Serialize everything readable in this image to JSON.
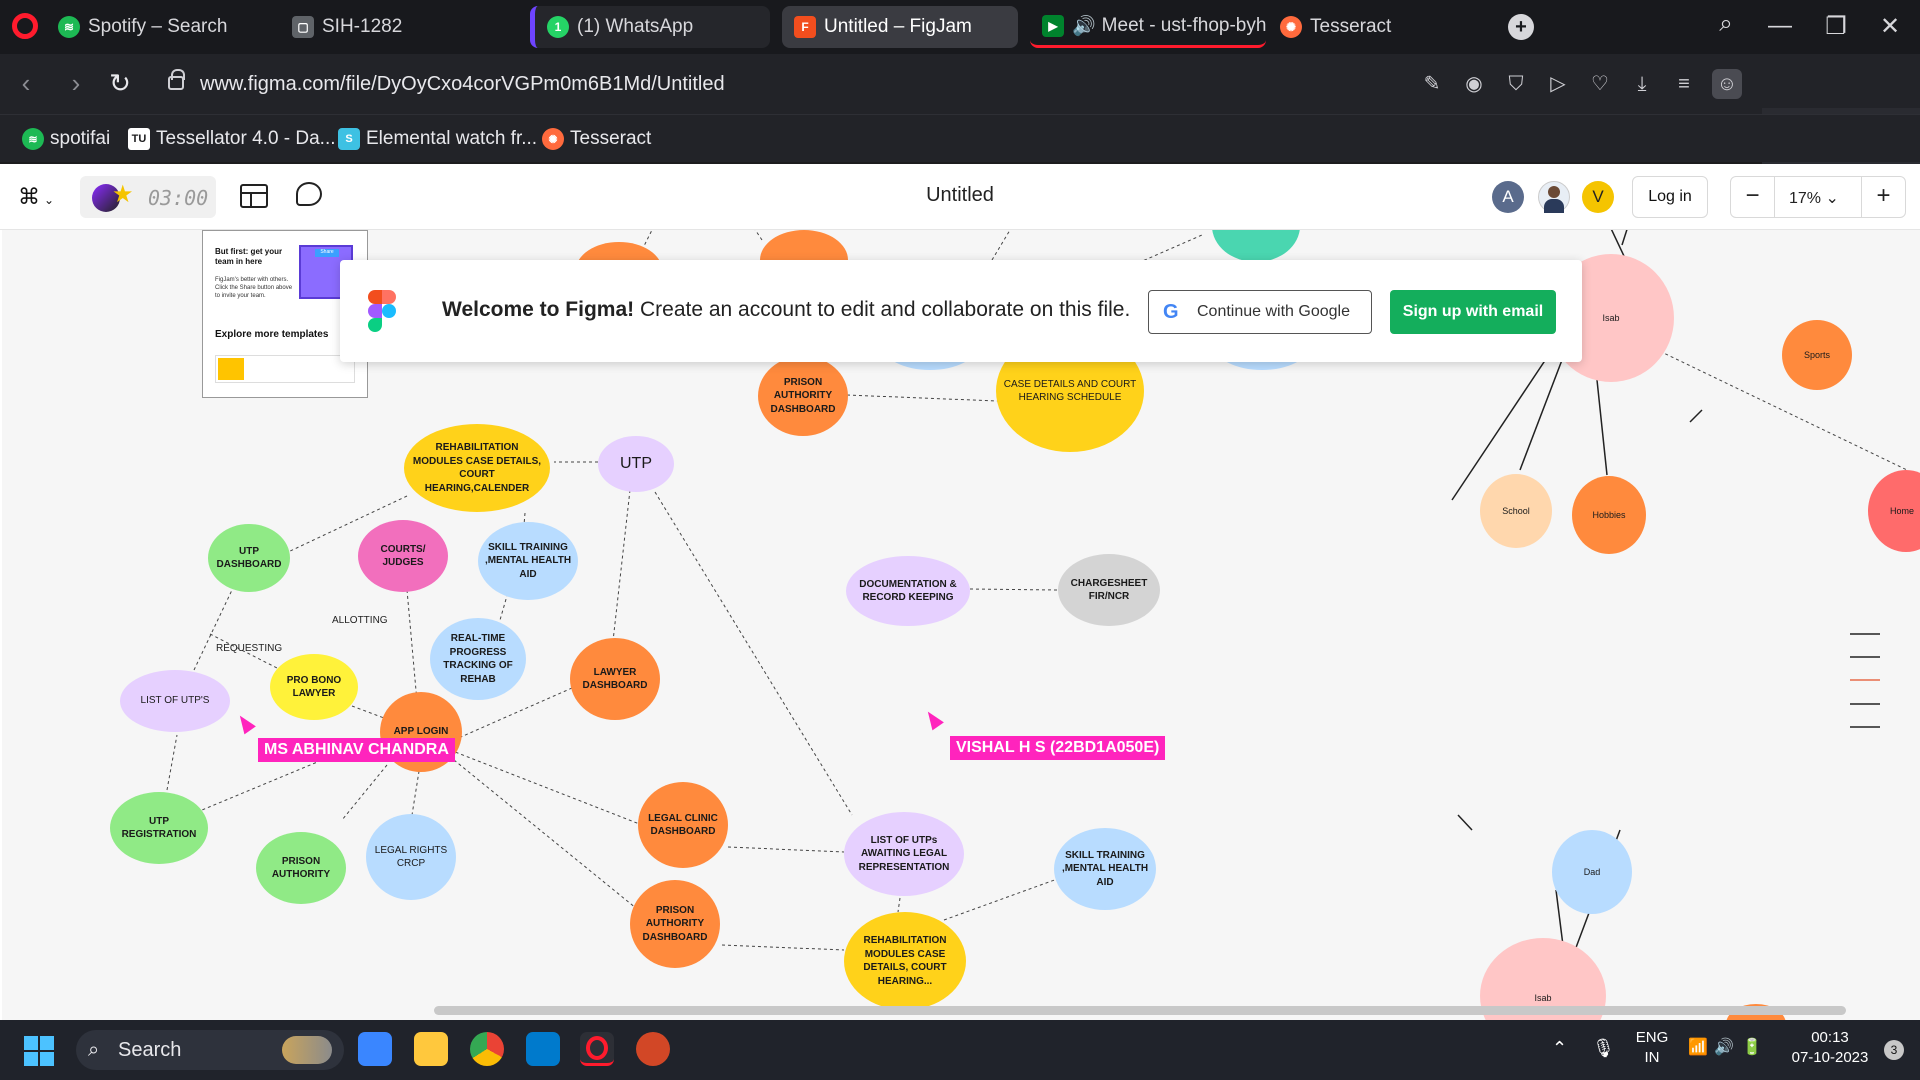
{
  "browser": {
    "tabs": [
      {
        "label": "Spotify – Search",
        "favicon": "spotify-icon"
      },
      {
        "label": "SIH-1282",
        "favicon": "sih-icon"
      },
      {
        "label": "(1) WhatsApp",
        "favicon": "whatsapp-icon"
      },
      {
        "label": "Untitled – FigJam",
        "favicon": "figma-icon",
        "active": true
      },
      {
        "label": "Meet - ust-fhop-byh",
        "favicon": "google-meet-icon"
      },
      {
        "label": "Tesseract",
        "favicon": "tesseract-icon"
      }
    ],
    "url": "www.figma.com/file/DyOyCxo4corVGPm0m6B1Md/Untitled",
    "bookmarks": [
      {
        "label": "spotifai",
        "favicon": "spotify-icon"
      },
      {
        "label": "Tessellator 4.0 - Da...",
        "favicon": "tu-icon"
      },
      {
        "label": "Elemental watch fr...",
        "favicon": "shopify-icon"
      },
      {
        "label": "Tesseract",
        "favicon": "tesseract-icon"
      }
    ]
  },
  "figma": {
    "timer": "03:00",
    "file_title": "Untitled",
    "avatars": [
      "A",
      "V"
    ],
    "login_label": "Log in",
    "zoom_label": "17%",
    "zoom_out": "−",
    "zoom_in": "+"
  },
  "banner": {
    "bold": "Welcome to Figma!",
    "text": " Create an account to edit and collaborate on this file.",
    "google_label": "Continue with Google",
    "email_label": "Sign up with email"
  },
  "template_card": {
    "title": "But first: get your team in here",
    "body": "FigJam's better with others. Click the Share button above to invite your team.",
    "share_label": "Share",
    "more": "Explore more templates"
  },
  "cursors": [
    {
      "name": "MS ABHINAV CHANDRA"
    },
    {
      "name": "VISHAL H S (22BD1A050E)"
    }
  ],
  "nodes": {
    "rehab_top": "REHABILITATION MODULES CASE DETAILS, COURT HEARING,CALENDER",
    "utp": "UTP",
    "utp_dashboard": "UTP DASHBOARD",
    "courts": "COURTS/ JUDGES",
    "skill_top": "SKILL TRAINING ,MENTAL HEALTH AID",
    "realtime": "REAL-TIME PROGRESS TRACKING OF REHAB",
    "lawyer_dash": "LAWYER DASHBOARD",
    "pro_bono": "PRO BONO LAWYER",
    "list_utps": "LIST OF UTP'S",
    "app_login": "APP LOGIN",
    "utp_reg": "UTP REGISTRATION",
    "prison_auth": "PRISON AUTHORITY",
    "legal_rights": "LEGAL RIGHTS CRCP",
    "legal_clinic": "LEGAL CLINIC DASHBOARD",
    "prison_auth_dash": "PRISON AUTHORITY DASHBOARD",
    "list_awaiting": "LIST OF UTPs AWAITING LEGAL REPRESENTATION",
    "skill_bottom": "SKILL TRAINING ,MENTAL HEALTH AID",
    "rehab_bottom": "REHABILITATION MODULES CASE DETAILS, COURT HEARING...",
    "documentation": "DOCUMENTATION & RECORD KEEPING",
    "chargesheet": "CHARGESHEET FIR/NCR",
    "prison_auth_dash_top": "PRISON AUTHORITY DASHBOARD",
    "case_details_top": "CASE DETAILS AND COURT HEARING SCHEDULE",
    "isab_top": "Isab",
    "sports": "Sports",
    "school": "School",
    "hobbies": "Hobbies",
    "home": "Home",
    "dad": "Dad",
    "isab_bottom": "Isab"
  },
  "edge_labels": {
    "allotting": "ALLOTTING",
    "requesting": "REQUESTING"
  },
  "taskbar": {
    "search": "Search",
    "lang": "ENG",
    "region": "IN",
    "time": "00:13",
    "date": "07-10-2023",
    "badge": "3"
  }
}
